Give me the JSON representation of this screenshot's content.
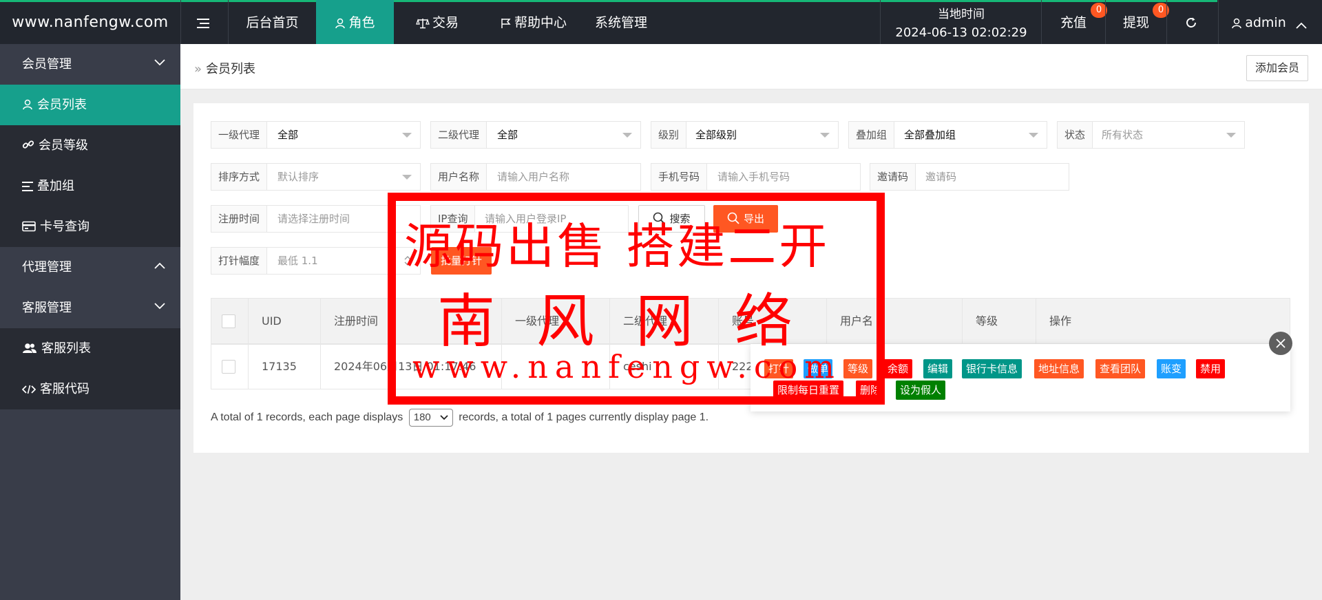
{
  "header": {
    "logo": "www.nanfengw.com",
    "nav": [
      "后台首页",
      "角色",
      "交易",
      "帮助中心",
      "系统管理"
    ],
    "clock_label": "当地时间",
    "clock_value": "2024-06-13 02:02:29",
    "recharge": "充值",
    "recharge_badge": "0",
    "withdraw": "提现",
    "withdraw_badge": "0",
    "user": "admin"
  },
  "sidebar": {
    "group1": "会员管理",
    "items1": [
      "会员列表",
      "会员等级",
      "叠加组",
      "卡号查询"
    ],
    "group2": "代理管理",
    "group3": "客服管理",
    "items3": [
      "客服列表",
      "客服代码"
    ]
  },
  "breadcrumb": "会员列表",
  "add_button": "添加会员",
  "filters": {
    "agent1": {
      "label": "一级代理",
      "value": "全部"
    },
    "agent2": {
      "label": "二级代理",
      "value": "全部"
    },
    "level": {
      "label": "级别",
      "value": "全部级别"
    },
    "group": {
      "label": "叠加组",
      "value": "全部叠加组"
    },
    "status": {
      "label": "状态",
      "value": "所有状态"
    },
    "sort": {
      "label": "排序方式",
      "value": "默认排序"
    },
    "username": {
      "label": "用户名称",
      "placeholder": "请输入用户名称"
    },
    "phone": {
      "label": "手机号码",
      "placeholder": "请输入手机号码"
    },
    "invite": {
      "label": "邀请码",
      "placeholder": "邀请码"
    },
    "regtime": {
      "label": "注册时间",
      "placeholder": "请选择注册时间"
    },
    "ip": {
      "label": "IP查询",
      "placeholder": "请输入用户登录IP"
    },
    "needle": {
      "label": "打针幅度",
      "placeholder": "最低 1.1"
    }
  },
  "buttons": {
    "search": "搜索",
    "export": "导出",
    "batch": "批量打针"
  },
  "table": {
    "headers": [
      "UID",
      "注册时间",
      "一级代理",
      "二级代理",
      "账号",
      "用户名",
      "等级",
      "操作"
    ],
    "rows": [
      {
        "uid": "17135",
        "regtime": "2024年06月13日 01:17:46",
        "agent1": "",
        "agent2": "ceshi",
        "account": "222"
      }
    ]
  },
  "actions": [
    "打针",
    "做单",
    "等级",
    "余额",
    "编辑",
    "银行卡信息",
    "地址信息",
    "查看团队",
    "账变",
    "禁用",
    "限制每日重置",
    "删除",
    "设为假人"
  ],
  "pager": {
    "pre": "A total of 1 records, each page displays",
    "size": "180",
    "post": "records, a total of 1 pages currently display page 1."
  },
  "watermark": {
    "line1": "源码出售 搭建二开",
    "line2": "南风网络",
    "line3": "www.nanfengw.com"
  },
  "colors": {
    "accent": "#16a08c",
    "orange": "#ff5722",
    "blue": "#1e9fff",
    "red": "#ff0000",
    "teal": "#009688",
    "green": "#008000",
    "header": "#22262e",
    "sidebar": "#393d49"
  }
}
